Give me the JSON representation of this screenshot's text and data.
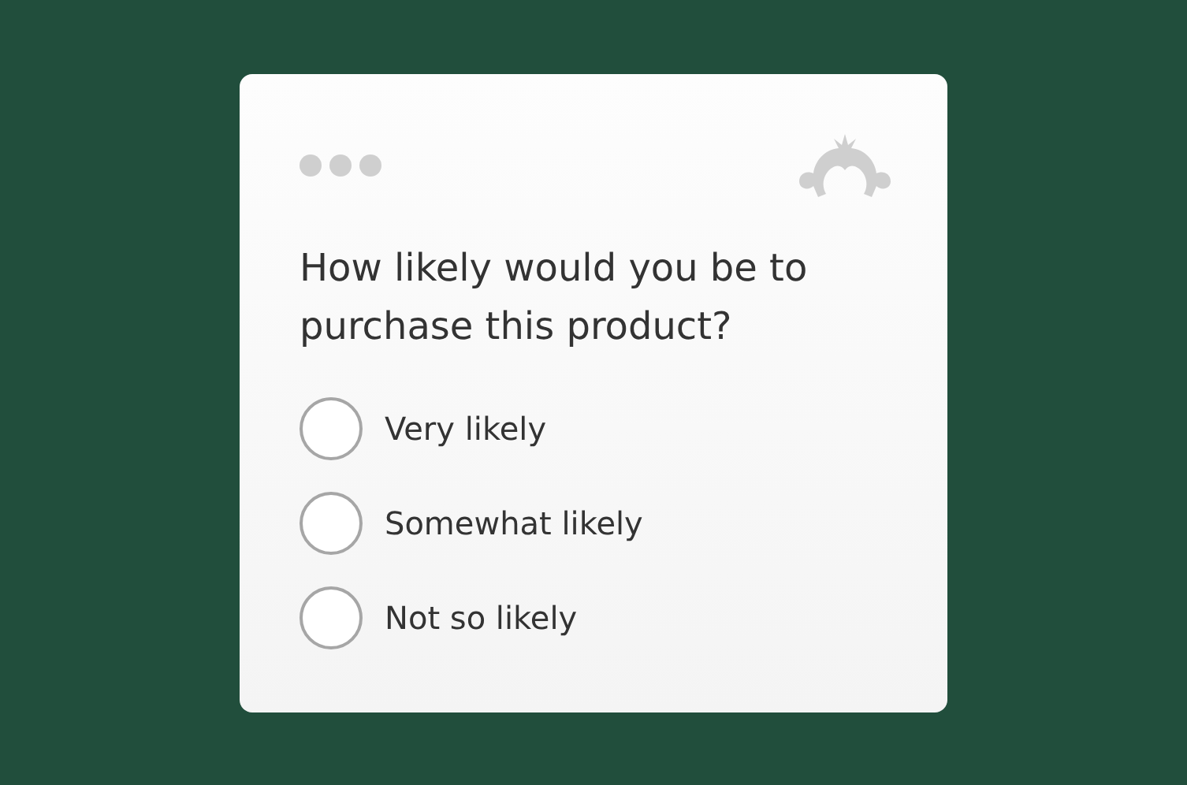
{
  "survey": {
    "question": "How likely would you be to purchase this product?",
    "options": [
      {
        "label": "Very likely",
        "selected": false
      },
      {
        "label": "Somewhat likely",
        "selected": false
      },
      {
        "label": "Not so likely",
        "selected": false
      }
    ]
  }
}
